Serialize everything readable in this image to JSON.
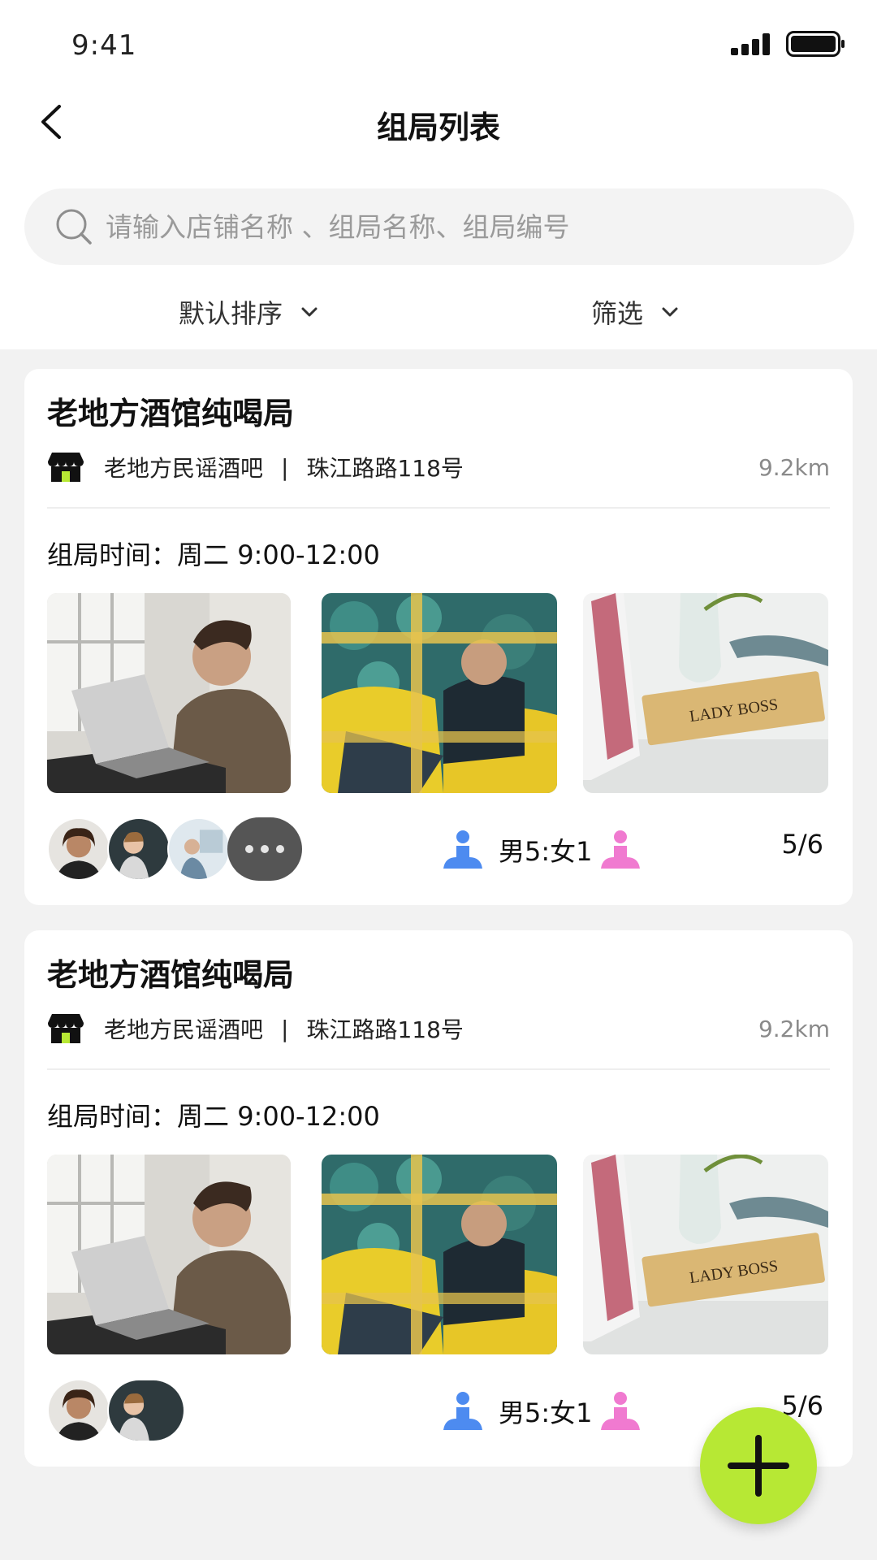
{
  "status_bar": {
    "time": "9:41"
  },
  "header": {
    "title": "组局列表",
    "back_icon": "chevron-left-icon"
  },
  "search": {
    "placeholder": "请输入店铺名称 、组局名称、组局编号",
    "icon": "search-icon"
  },
  "filters": {
    "sort_label": "默认排序",
    "filter_label": "筛选"
  },
  "colors": {
    "accent": "#b7e834",
    "male": "#4d8bf0",
    "female": "#f07ad0",
    "background": "#f2f2f2"
  },
  "cards": [
    {
      "title": "老地方酒馆纯喝局",
      "shop_name": "老地方民谣酒吧",
      "separator": "|",
      "address": "珠江路路118号",
      "distance": "9.2km",
      "time_label": "组局时间：",
      "time_value": "周二 9:00-12:00",
      "photo_sign": "LADY BOSS",
      "ratio": "男5:女1",
      "count": "5/6"
    },
    {
      "title": "老地方酒馆纯喝局",
      "shop_name": "老地方民谣酒吧",
      "separator": "|",
      "address": "珠江路路118号",
      "distance": "9.2km",
      "time_label": "组局时间：",
      "time_value": "周二 9:00-12:00",
      "photo_sign": "LADY BOSS",
      "ratio": "男5:女1",
      "count": "5/6"
    }
  ],
  "fab": {
    "icon": "plus-icon"
  }
}
